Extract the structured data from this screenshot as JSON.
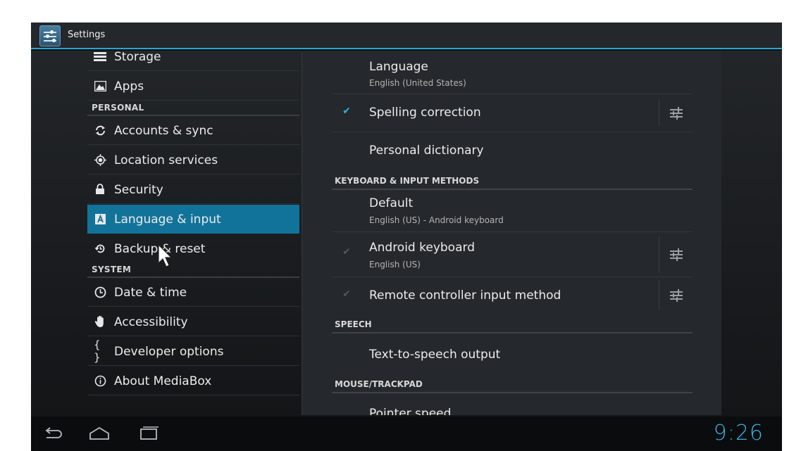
{
  "action_bar": {
    "title": "Settings",
    "icon": "settings-app-icon"
  },
  "left_list": [
    {
      "type": "item",
      "label": "Storage",
      "icon": "storage-icon"
    },
    {
      "type": "item",
      "label": "Apps",
      "icon": "apps-icon"
    },
    {
      "type": "header",
      "label": "PERSONAL"
    },
    {
      "type": "item",
      "label": "Accounts & sync",
      "icon": "sync-icon"
    },
    {
      "type": "item",
      "label": "Location services",
      "icon": "location-icon"
    },
    {
      "type": "item",
      "label": "Security",
      "icon": "lock-icon"
    },
    {
      "type": "item",
      "label": "Language & input",
      "icon": "language-icon",
      "selected": true
    },
    {
      "type": "item",
      "label": "Backup & reset",
      "icon": "backup-icon"
    },
    {
      "type": "header",
      "label": "SYSTEM"
    },
    {
      "type": "item",
      "label": "Date & time",
      "icon": "clock-icon"
    },
    {
      "type": "item",
      "label": "Accessibility",
      "icon": "hand-icon"
    },
    {
      "type": "item",
      "label": "Developer options",
      "icon": "braces-icon"
    },
    {
      "type": "item",
      "label": "About MediaBox",
      "icon": "info-icon"
    }
  ],
  "right_panel": {
    "language": {
      "title": "Language",
      "subtitle": "English (United States)"
    },
    "spelling": {
      "title": "Spelling correction",
      "checked": true
    },
    "dictionary": {
      "title": "Personal dictionary"
    },
    "keyboard_header": "KEYBOARD & INPUT METHODS",
    "default": {
      "title": "Default",
      "subtitle": "English (US) - Android keyboard"
    },
    "android_keyboard": {
      "title": "Android keyboard",
      "subtitle": "English (US)",
      "checked": true,
      "enabled": false
    },
    "remote_controller": {
      "title": "Remote controller input method",
      "checked": true,
      "enabled": false
    },
    "speech_header": "SPEECH",
    "tts": {
      "title": "Text-to-speech output"
    },
    "mouse_header": "MOUSE/TRACKPAD",
    "pointer_speed": {
      "title": "Pointer speed"
    }
  },
  "nav_bar": {
    "buttons": [
      "back-icon",
      "home-icon",
      "recents-icon"
    ],
    "clock": "9:26"
  },
  "colors": {
    "accent": "#33b5e5",
    "selected": "#12739a",
    "action_bar_line": "#2aa6c9"
  }
}
